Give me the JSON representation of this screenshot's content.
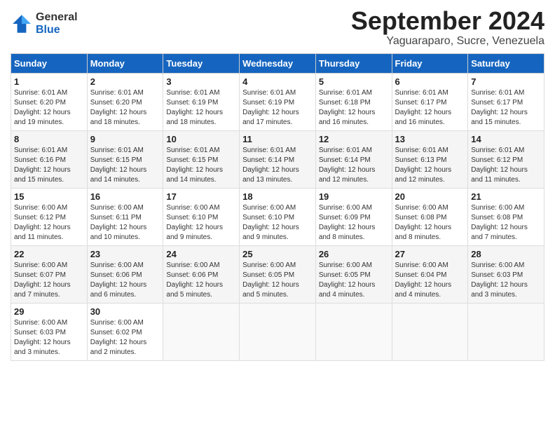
{
  "logo": {
    "general": "General",
    "blue": "Blue"
  },
  "title": "September 2024",
  "subtitle": "Yaguaraparo, Sucre, Venezuela",
  "headers": [
    "Sunday",
    "Monday",
    "Tuesday",
    "Wednesday",
    "Thursday",
    "Friday",
    "Saturday"
  ],
  "weeks": [
    [
      {
        "day": "1",
        "info": "Sunrise: 6:01 AM\nSunset: 6:20 PM\nDaylight: 12 hours\nand 19 minutes."
      },
      {
        "day": "2",
        "info": "Sunrise: 6:01 AM\nSunset: 6:20 PM\nDaylight: 12 hours\nand 18 minutes."
      },
      {
        "day": "3",
        "info": "Sunrise: 6:01 AM\nSunset: 6:19 PM\nDaylight: 12 hours\nand 18 minutes."
      },
      {
        "day": "4",
        "info": "Sunrise: 6:01 AM\nSunset: 6:19 PM\nDaylight: 12 hours\nand 17 minutes."
      },
      {
        "day": "5",
        "info": "Sunrise: 6:01 AM\nSunset: 6:18 PM\nDaylight: 12 hours\nand 16 minutes."
      },
      {
        "day": "6",
        "info": "Sunrise: 6:01 AM\nSunset: 6:17 PM\nDaylight: 12 hours\nand 16 minutes."
      },
      {
        "day": "7",
        "info": "Sunrise: 6:01 AM\nSunset: 6:17 PM\nDaylight: 12 hours\nand 15 minutes."
      }
    ],
    [
      {
        "day": "8",
        "info": "Sunrise: 6:01 AM\nSunset: 6:16 PM\nDaylight: 12 hours\nand 15 minutes."
      },
      {
        "day": "9",
        "info": "Sunrise: 6:01 AM\nSunset: 6:15 PM\nDaylight: 12 hours\nand 14 minutes."
      },
      {
        "day": "10",
        "info": "Sunrise: 6:01 AM\nSunset: 6:15 PM\nDaylight: 12 hours\nand 14 minutes."
      },
      {
        "day": "11",
        "info": "Sunrise: 6:01 AM\nSunset: 6:14 PM\nDaylight: 12 hours\nand 13 minutes."
      },
      {
        "day": "12",
        "info": "Sunrise: 6:01 AM\nSunset: 6:14 PM\nDaylight: 12 hours\nand 12 minutes."
      },
      {
        "day": "13",
        "info": "Sunrise: 6:01 AM\nSunset: 6:13 PM\nDaylight: 12 hours\nand 12 minutes."
      },
      {
        "day": "14",
        "info": "Sunrise: 6:01 AM\nSunset: 6:12 PM\nDaylight: 12 hours\nand 11 minutes."
      }
    ],
    [
      {
        "day": "15",
        "info": "Sunrise: 6:00 AM\nSunset: 6:12 PM\nDaylight: 12 hours\nand 11 minutes."
      },
      {
        "day": "16",
        "info": "Sunrise: 6:00 AM\nSunset: 6:11 PM\nDaylight: 12 hours\nand 10 minutes."
      },
      {
        "day": "17",
        "info": "Sunrise: 6:00 AM\nSunset: 6:10 PM\nDaylight: 12 hours\nand 9 minutes."
      },
      {
        "day": "18",
        "info": "Sunrise: 6:00 AM\nSunset: 6:10 PM\nDaylight: 12 hours\nand 9 minutes."
      },
      {
        "day": "19",
        "info": "Sunrise: 6:00 AM\nSunset: 6:09 PM\nDaylight: 12 hours\nand 8 minutes."
      },
      {
        "day": "20",
        "info": "Sunrise: 6:00 AM\nSunset: 6:08 PM\nDaylight: 12 hours\nand 8 minutes."
      },
      {
        "day": "21",
        "info": "Sunrise: 6:00 AM\nSunset: 6:08 PM\nDaylight: 12 hours\nand 7 minutes."
      }
    ],
    [
      {
        "day": "22",
        "info": "Sunrise: 6:00 AM\nSunset: 6:07 PM\nDaylight: 12 hours\nand 7 minutes."
      },
      {
        "day": "23",
        "info": "Sunrise: 6:00 AM\nSunset: 6:06 PM\nDaylight: 12 hours\nand 6 minutes."
      },
      {
        "day": "24",
        "info": "Sunrise: 6:00 AM\nSunset: 6:06 PM\nDaylight: 12 hours\nand 5 minutes."
      },
      {
        "day": "25",
        "info": "Sunrise: 6:00 AM\nSunset: 6:05 PM\nDaylight: 12 hours\nand 5 minutes."
      },
      {
        "day": "26",
        "info": "Sunrise: 6:00 AM\nSunset: 6:05 PM\nDaylight: 12 hours\nand 4 minutes."
      },
      {
        "day": "27",
        "info": "Sunrise: 6:00 AM\nSunset: 6:04 PM\nDaylight: 12 hours\nand 4 minutes."
      },
      {
        "day": "28",
        "info": "Sunrise: 6:00 AM\nSunset: 6:03 PM\nDaylight: 12 hours\nand 3 minutes."
      }
    ],
    [
      {
        "day": "29",
        "info": "Sunrise: 6:00 AM\nSunset: 6:03 PM\nDaylight: 12 hours\nand 3 minutes."
      },
      {
        "day": "30",
        "info": "Sunrise: 6:00 AM\nSunset: 6:02 PM\nDaylight: 12 hours\nand 2 minutes."
      },
      {
        "day": "",
        "info": ""
      },
      {
        "day": "",
        "info": ""
      },
      {
        "day": "",
        "info": ""
      },
      {
        "day": "",
        "info": ""
      },
      {
        "day": "",
        "info": ""
      }
    ]
  ]
}
